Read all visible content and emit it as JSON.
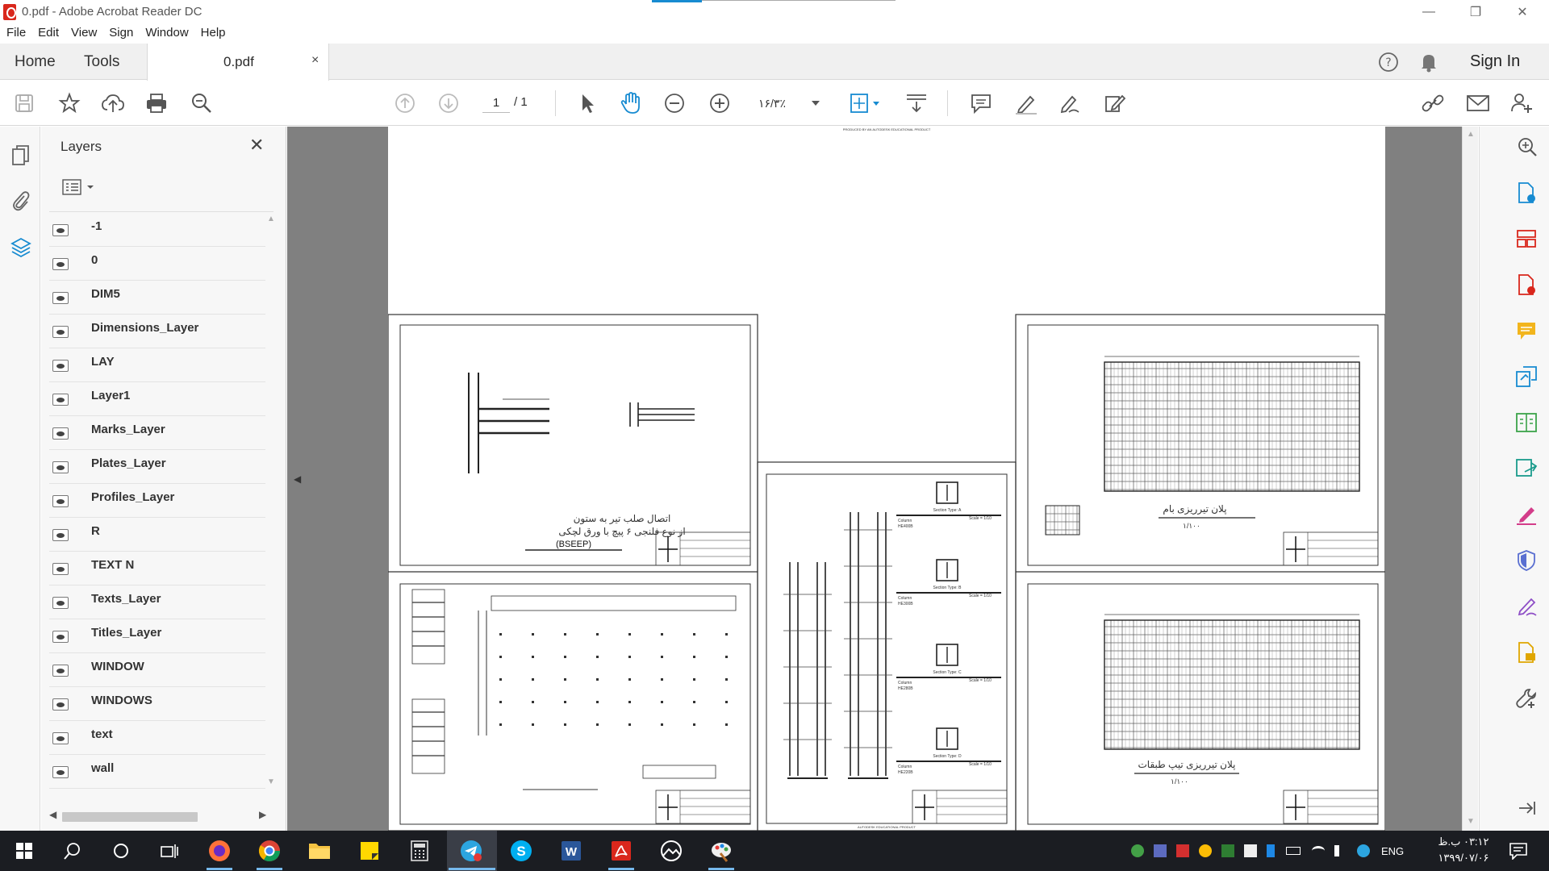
{
  "window": {
    "title": "0.pdf - Adobe Acrobat Reader DC"
  },
  "menu": [
    "File",
    "Edit",
    "View",
    "Sign",
    "Window",
    "Help"
  ],
  "tabs": {
    "home": "Home",
    "tools": "Tools",
    "doc": "0.pdf",
    "close": "×",
    "sign_in": "Sign In"
  },
  "toolbar": {
    "page_current": "1",
    "page_total": "/ 1",
    "zoom": "۱۶/۳٪"
  },
  "layers": {
    "title": "Layers",
    "items": [
      "-1",
      "0",
      "DIM5",
      "Dimensions_Layer",
      "LAY",
      "Layer1",
      "Marks_Layer",
      "Plates_Layer",
      "Profiles_Layer",
      "R",
      "TEXT N",
      "Texts_Layer",
      "Titles_Layer",
      "WINDOW",
      "WINDOWS",
      "text",
      "wall"
    ]
  },
  "drawing": {
    "header": "PRODUCED BY AN AUTODESK EDUCATIONAL PRODUCT",
    "connection_title_1": "اتصال صلب تیر به ستون",
    "connection_title_2": "از نوع فلنجی ۶ پیچ با ورق لچکی",
    "connection_code": "(BSEEP)",
    "roof_plan": "پلان تیرریزی بام",
    "floor_plan": "پلان تیرریزی تیپ طبقات",
    "scale": "۱/۱۰۰",
    "section_a": "Section Type: A",
    "section_b": "Section Type: B",
    "section_c": "Section Type: C",
    "section_d": "Section Type: D",
    "col_a": "HE400B",
    "col_b": "HE300B",
    "col_c": "HE280B",
    "col_d": "HE220B",
    "scale_label": "Scale = 1/10",
    "column_label": "Column",
    "footer": "AUTODESK EDUCATIONAL PRODUCT"
  },
  "clock": {
    "time": "۰۳:۱۲ ب.ظ",
    "date": "۱۳۹۹/۰۷/۰۶"
  },
  "tray": {
    "lang": "ENG"
  }
}
